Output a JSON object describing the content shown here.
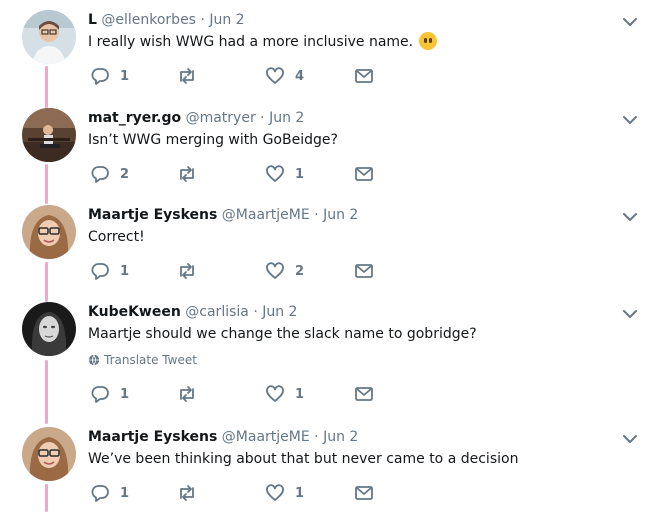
{
  "tweets": [
    {
      "name": "L",
      "handle": "@ellenkorbes",
      "dot": "·",
      "date": "Jun 2",
      "text": "I really wish WWG had a more inclusive name.",
      "emoji": "no-mouth-face",
      "replies": "1",
      "retweets": "",
      "likes": "4"
    },
    {
      "name": "mat_ryer.go",
      "handle": "@matryer",
      "dot": "·",
      "date": "Jun 2",
      "text": "Isn’t WWG merging with GoBeidge?",
      "replies": "2",
      "retweets": "",
      "likes": "1"
    },
    {
      "name": "Maartje Eyskens",
      "handle": "@MaartjeME",
      "dot": "·",
      "date": "Jun 2",
      "text": "Correct!",
      "replies": "1",
      "retweets": "",
      "likes": "2"
    },
    {
      "name": "KubeKween",
      "handle": "@carlisia",
      "dot": "·",
      "date": "Jun 2",
      "text": "Maartje should we change the slack name to gobridge?",
      "translate": "Translate Tweet",
      "replies": "1",
      "retweets": "",
      "likes": "1"
    },
    {
      "name": "Maartje Eyskens",
      "handle": "@MaartjeME",
      "dot": "·",
      "date": "Jun 2",
      "text": "We’ve been thinking about that but never came to a decision",
      "replies": "1",
      "retweets": "",
      "likes": "1"
    }
  ],
  "colors": {
    "thread_line": "#f0a7c8",
    "icon_gray": "#657786",
    "text": "#14171a"
  },
  "icons": {
    "reply": "reply-icon",
    "retweet": "retweet-icon",
    "like": "heart-icon",
    "dm": "envelope-icon",
    "menu": "chevron-down-icon",
    "translate": "globe-icon"
  }
}
